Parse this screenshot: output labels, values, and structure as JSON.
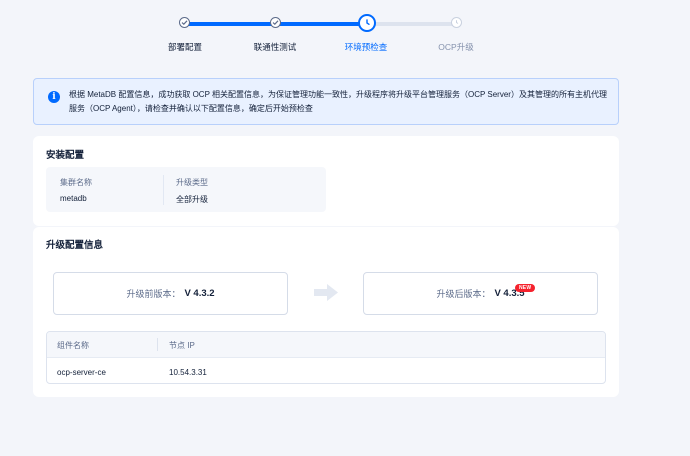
{
  "steps": [
    {
      "label": "部署配置",
      "state": "done"
    },
    {
      "label": "联通性测试",
      "state": "done"
    },
    {
      "label": "环境预检查",
      "state": "current"
    },
    {
      "label": "OCP升级",
      "state": "todo"
    }
  ],
  "alert": {
    "icon": "info-icon",
    "text": "根据 MetaDB 配置信息，成功获取 OCP 相关配置信息，为保证管理功能一致性，升级程序将升级平台管理服务（OCP Server）及其管理的所有主机代理服务（OCP Agent），请检查并确认以下配置信息，确定后开始预检查"
  },
  "install_config": {
    "title": "安装配置",
    "cluster_label": "集群名称",
    "cluster_value": "metadb",
    "upgrade_type_label": "升级类型",
    "upgrade_type_value": "全部升级"
  },
  "upgrade_info": {
    "title": "升级配置信息",
    "before_label": "升级前版本：",
    "before_version": "V 4.3.2",
    "after_label": "升级后版本：",
    "after_version": "V 4.3.5",
    "new_badge": "NEW",
    "table": {
      "headers": [
        "组件名称",
        "节点 IP"
      ],
      "rows": [
        [
          "ocp-server-ce",
          "10.54.3.31"
        ]
      ]
    }
  },
  "colors": {
    "accent": "#006aff",
    "badge": "#f5222d"
  }
}
